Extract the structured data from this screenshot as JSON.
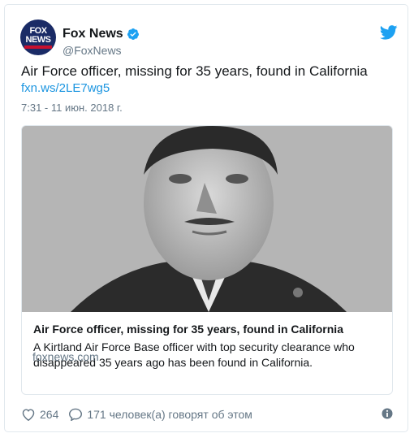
{
  "author": {
    "name": "Fox News",
    "handle": "@FoxNews",
    "avatar_line1": "FOX",
    "avatar_line2": "NEWS",
    "verified": true
  },
  "tweet": {
    "text": "Air Force officer, missing for 35 years, found in California",
    "link": "fxn.ws/2LE7wg5",
    "timestamp": "7:31 - 11 июн. 2018 г."
  },
  "link_card": {
    "image_alt": "Black and white portrait photo of an Air Force officer",
    "title": "Air Force officer, missing for 35 years, found in California",
    "description": "A Kirtland Air Force Base officer with top security clearance who disappeared 35 years ago has been found in California.",
    "domain": "foxnews.com"
  },
  "actions": {
    "likes": "264",
    "replies": "171 человек(а) говорят об этом"
  },
  "colors": {
    "link_blue": "#1b95e0",
    "twitter_blue": "#1da1f2",
    "muted_gray": "#657786",
    "fox_navy": "#1a2b66"
  },
  "icons": [
    "verified-icon",
    "twitter-bird-icon",
    "heart-icon",
    "reply-icon",
    "info-icon"
  ]
}
